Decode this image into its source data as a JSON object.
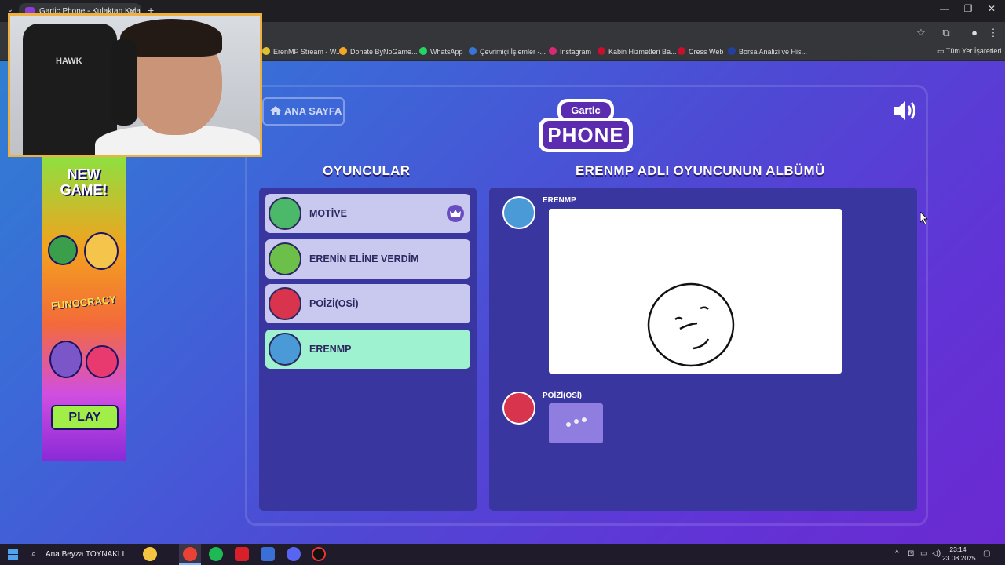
{
  "browser": {
    "tab_title": "Gartic Phone - Kulaktan Kulağa",
    "tab_close": "✕",
    "new_tab": "+",
    "window_controls": [
      "—",
      "❐",
      "✕"
    ],
    "bookmarks": [
      {
        "label": "ErenMP Stream - W...",
        "color": "#e0c030"
      },
      {
        "label": "Donate ByNoGame...",
        "color": "#f5a623"
      },
      {
        "label": "WhatsApp",
        "color": "#25d366"
      },
      {
        "label": "Çevrimiçi İşlemler -...",
        "color": "#3b74d8"
      },
      {
        "label": "Instagram",
        "color": "#d62976"
      },
      {
        "label": "Kabin Hizmetleri Ba...",
        "color": "#c8102e"
      },
      {
        "label": "Cress Web",
        "color": "#c8102e"
      },
      {
        "label": "Borsa Analizi ve His...",
        "color": "#2240a0"
      }
    ],
    "all_bookmarks": "Tüm Yer İşaretleri"
  },
  "webcam": {
    "chair_brand": "HAWK"
  },
  "ad": {
    "title_line1": "NEW",
    "title_line2": "GAME!",
    "brand": "FUNOCRACY",
    "play_label": "PLAY"
  },
  "game": {
    "home_label": "ANA SAYFA",
    "logo_top": "Gartic",
    "logo_main": "PHONE",
    "players_header": "OYUNCULAR",
    "album_header": "ERENMP ADLI OYUNCUNUN ALBÜMÜ",
    "players": [
      {
        "name": "MOTİVE",
        "active": false,
        "host": true
      },
      {
        "name": "ERENİN ELİNE VERDİM",
        "active": false,
        "host": false
      },
      {
        "name": "POİZİ(OSİ)",
        "active": false,
        "host": false
      },
      {
        "name": "ERENMP",
        "active": true,
        "host": false
      }
    ],
    "album": [
      {
        "author": "ERENMP",
        "type": "drawing"
      },
      {
        "author": "POİZİ(OSİ)",
        "type": "loading"
      }
    ]
  },
  "taskbar": {
    "search_text": "Ana Beyza TOYNAKLI",
    "time": "23:14",
    "date": "23.08.2025"
  },
  "colors": {
    "accent": "#5b2bb0",
    "player_bg": "#c9c8ee",
    "player_active_bg": "#9ef2cf",
    "panel_bg": "#3a36a0"
  }
}
